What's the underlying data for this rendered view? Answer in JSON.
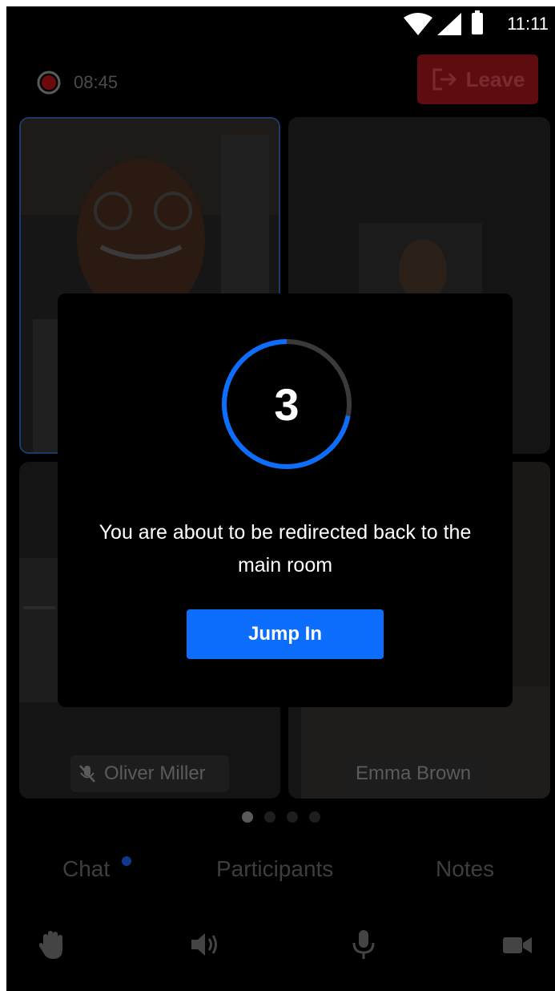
{
  "status_bar": {
    "time": "11:11",
    "icons": [
      "wifi-icon",
      "signal-icon",
      "battery-icon"
    ]
  },
  "header": {
    "timer": "08:45",
    "recording_icon": "record-icon",
    "leave_label": "Leave",
    "leave_icon": "exit-icon"
  },
  "participants": [
    {
      "name": "",
      "tile": "speaker-active"
    },
    {
      "name": "",
      "tile": "camera"
    },
    {
      "name": "Oliver Miller",
      "muted": true,
      "mic_icon": "mic-off-icon"
    },
    {
      "name": "Emma Brown",
      "muted": false
    }
  ],
  "pager": {
    "pages": 4,
    "current": 1
  },
  "tabs": [
    {
      "label": "Chat",
      "has_badge": true
    },
    {
      "label": "Participants"
    },
    {
      "label": "Notes"
    }
  ],
  "controls": [
    "raise-hand-icon",
    "speaker-icon",
    "microphone-icon",
    "camera-icon"
  ],
  "redirect_dialog": {
    "countdown": "3",
    "progress_fraction": 0.72,
    "message": "You are about to be redirected back to the main room",
    "button_label": "Jump In"
  },
  "colors": {
    "accent": "#0d6efd",
    "leave": "#5e0c10",
    "ring_track": "#3a3a3a"
  }
}
